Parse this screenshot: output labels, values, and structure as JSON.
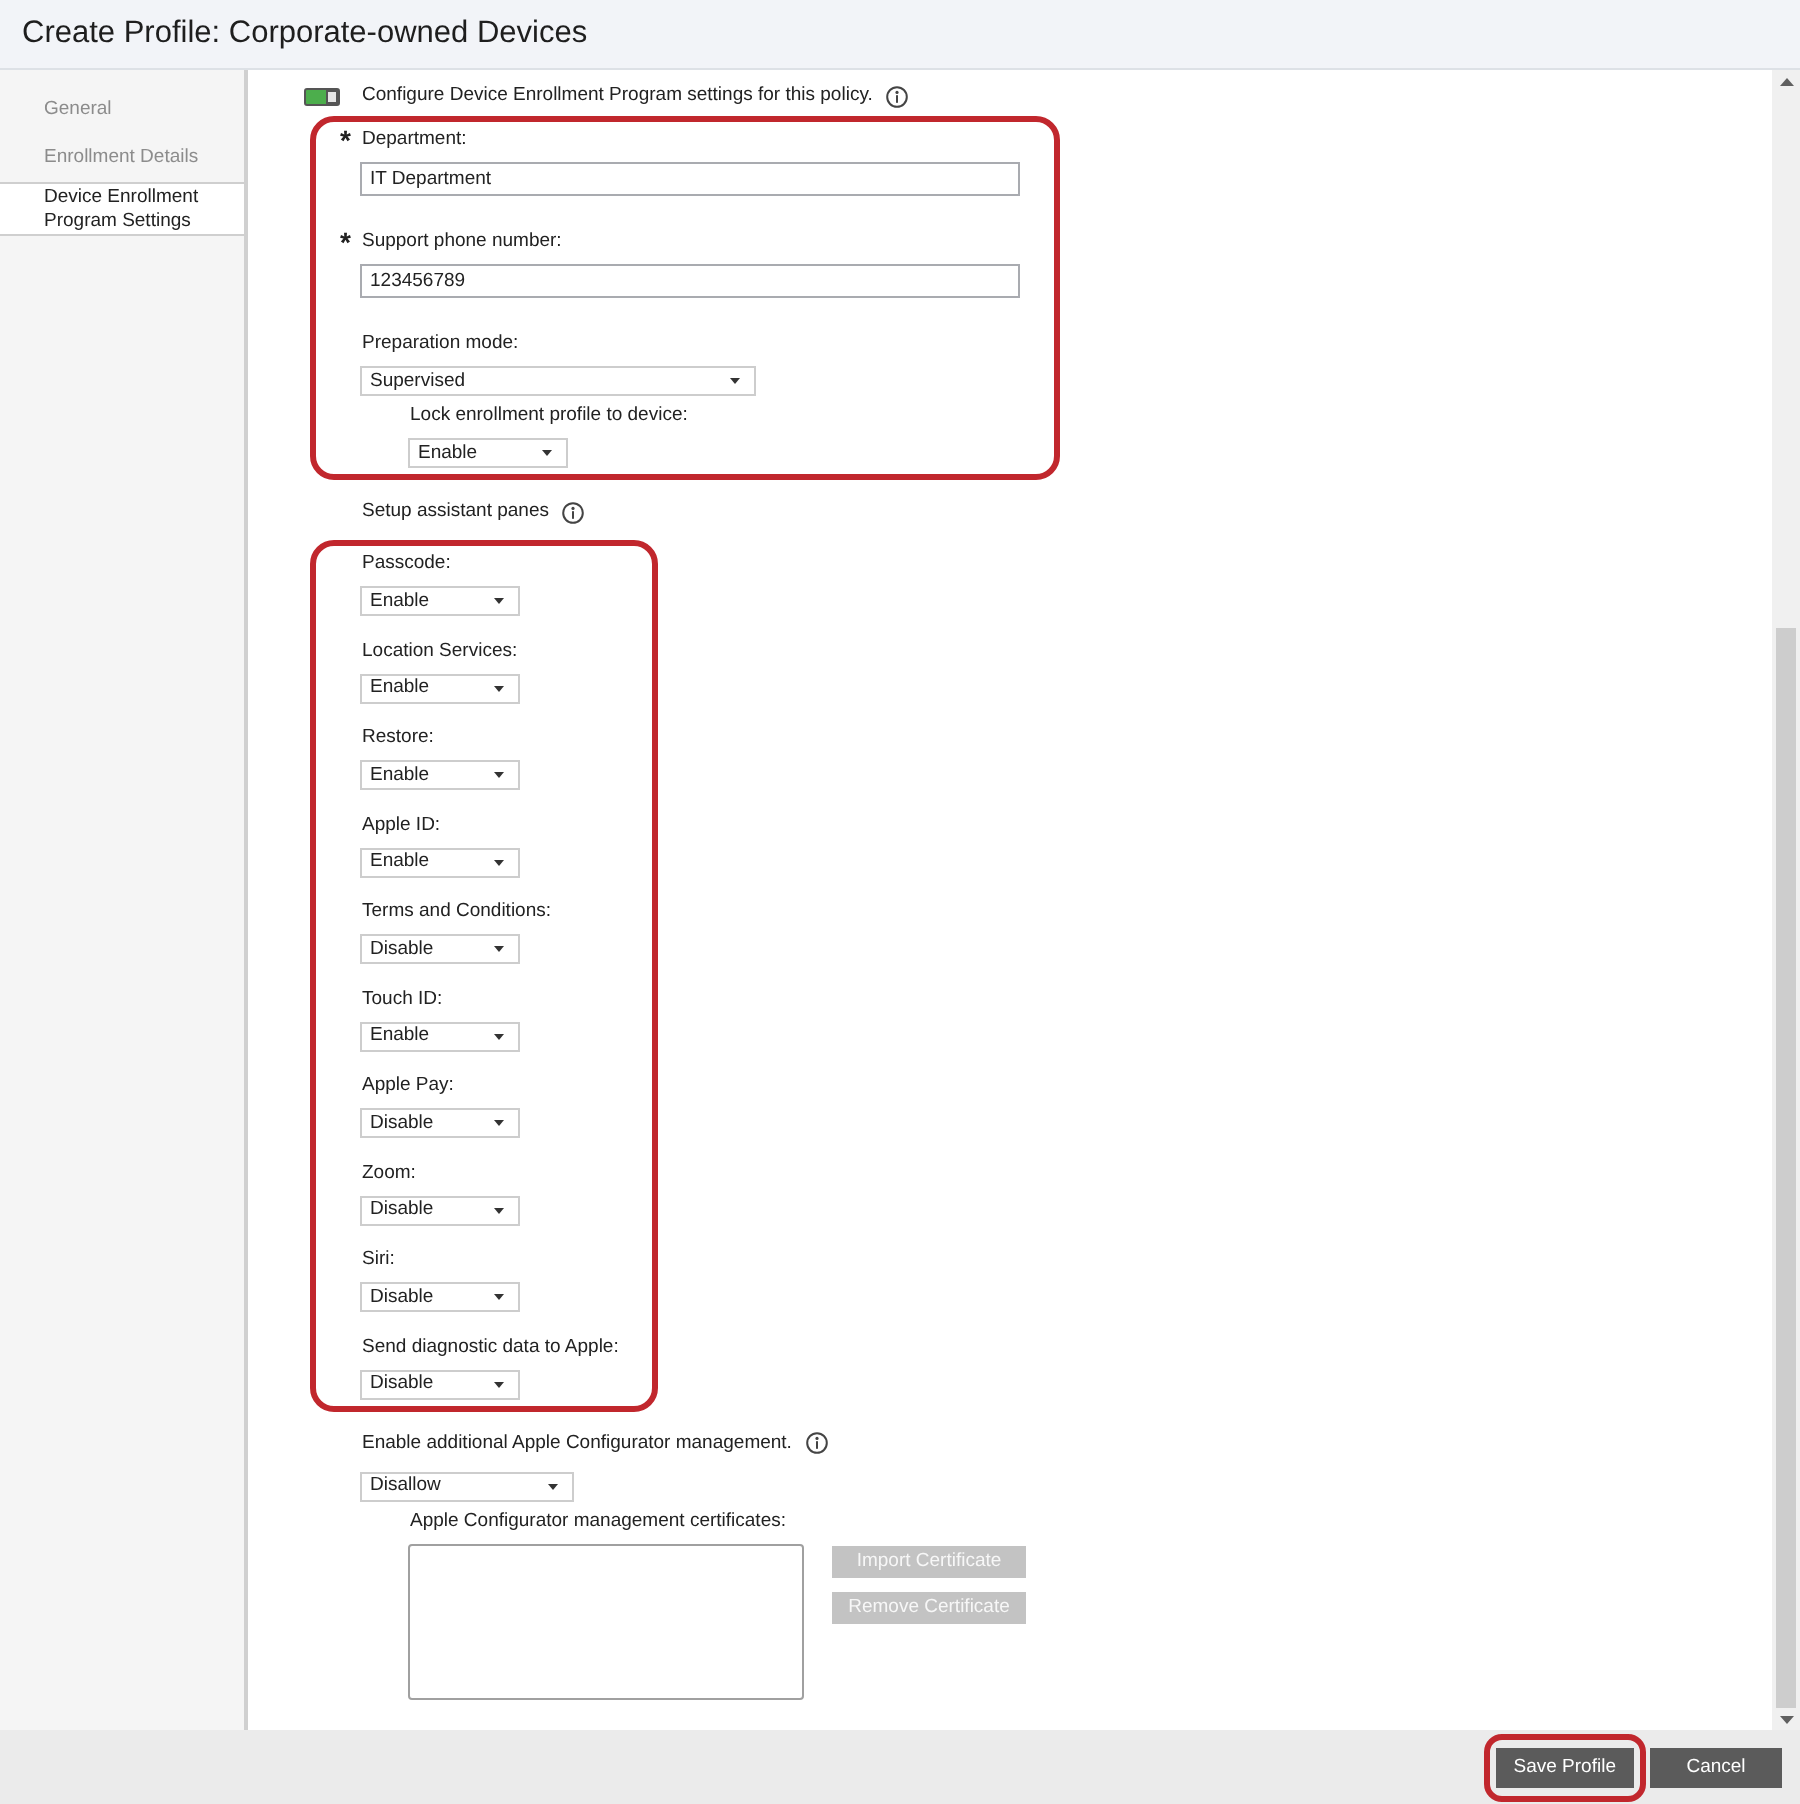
{
  "window": {
    "title": "Create Profile: Corporate-owned Devices"
  },
  "sidebar": {
    "items": [
      {
        "label": "General",
        "selected": false
      },
      {
        "label": "Enrollment Details",
        "selected": false
      },
      {
        "label": "Device Enrollment Program Settings",
        "selected": true
      }
    ]
  },
  "form": [
    {
      "kind": "toggle",
      "label": "Configure Device Enrollment Program settings for this policy.",
      "on": true
    },
    {
      "kind": "group",
      "highlighted": true,
      "fields": [
        {
          "kind": "text",
          "required_mark": "*",
          "label": "Department:",
          "value": "IT Department"
        },
        {
          "kind": "text",
          "required_mark": "*",
          "label": "Support phone number:",
          "value": "123456789"
        },
        {
          "kind": "select",
          "label": "Preparation mode:",
          "value": "Supervised",
          "children": [
            {
              "kind": "select",
              "label": "Lock enrollment profile to device:",
              "value": "Enable"
            }
          ]
        }
      ]
    },
    {
      "kind": "heading",
      "label": "Setup assistant panes"
    },
    {
      "kind": "group",
      "highlighted": true,
      "fields": [
        {
          "kind": "select",
          "label": "Passcode:",
          "value": "Enable"
        },
        {
          "kind": "select",
          "label": "Location Services:",
          "value": "Enable"
        },
        {
          "kind": "select",
          "label": "Restore:",
          "value": "Enable"
        },
        {
          "kind": "select",
          "label": "Apple ID:",
          "value": "Enable"
        },
        {
          "kind": "select",
          "label": "Terms and Conditions:",
          "value": "Disable"
        },
        {
          "kind": "select",
          "label": "Touch ID:",
          "value": "Enable"
        },
        {
          "kind": "select",
          "label": "Apple Pay:",
          "value": "Disable"
        },
        {
          "kind": "select",
          "label": "Zoom:",
          "value": "Disable"
        },
        {
          "kind": "select",
          "label": "Siri:",
          "value": "Disable"
        },
        {
          "kind": "select",
          "label": "Send diagnostic data to Apple:",
          "value": "Disable"
        }
      ]
    },
    {
      "kind": "heading",
      "label": "Enable additional Apple Configurator management."
    },
    {
      "kind": "select",
      "value": "Disallow",
      "children": [
        {
          "kind": "list",
          "label": "Apple Configurator management certificates:",
          "buttons": [
            {
              "label": "Import Certificate",
              "disabled": true
            },
            {
              "label": "Remove Certificate",
              "disabled": true
            }
          ]
        }
      ]
    }
  ],
  "footer": {
    "buttons": [
      {
        "label": "Save Profile",
        "highlighted": true
      },
      {
        "label": "Cancel",
        "highlighted": false
      }
    ]
  }
}
